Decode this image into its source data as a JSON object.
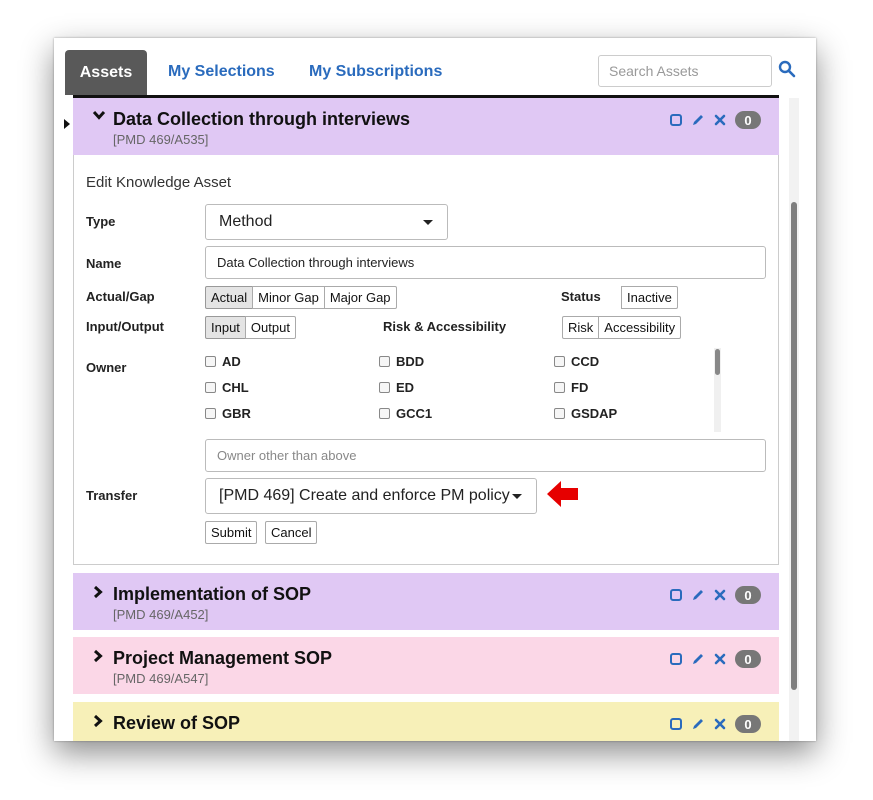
{
  "tabs": {
    "assets": "Assets",
    "my_selections": "My Selections",
    "my_subscriptions": "My Subscriptions"
  },
  "search": {
    "placeholder": "Search Assets",
    "icon": "search-icon"
  },
  "colors": {
    "tab_active": "#595959",
    "link": "#2a6bbd",
    "panel_purple": "#e0c8f4",
    "panel_pink": "#fbd7e7",
    "panel_yellow": "#f7f0b8",
    "icon_blue": "#2a6bbd",
    "arrow_red": "#e60000"
  },
  "assets": [
    {
      "title": "Data Collection through interviews",
      "code": "[PMD 469/A535]",
      "count": "0",
      "expanded": true
    },
    {
      "title": "Implementation of SOP",
      "code": "[PMD 469/A452]",
      "count": "0",
      "expanded": false
    },
    {
      "title": "Project Management SOP",
      "code": "[PMD 469/A547]",
      "count": "0",
      "expanded": false
    },
    {
      "title": "Review of SOP",
      "count": "0",
      "expanded": false
    }
  ],
  "form": {
    "heading": "Edit Knowledge Asset",
    "type_label": "Type",
    "type_value": "Method",
    "name_label": "Name",
    "name_value": "Data Collection through interviews",
    "actual_gap_label": "Actual/Gap",
    "actual_gap_options": [
      "Actual",
      "Minor Gap",
      "Major Gap"
    ],
    "actual_gap_selected": "Actual",
    "status_label": "Status",
    "status_options": [
      "Inactive"
    ],
    "input_output_label": "Input/Output",
    "input_output_options": [
      "Input",
      "Output"
    ],
    "input_output_selected": "Input",
    "risk_label": "Risk & Accessibility",
    "risk_options": [
      "Risk",
      "Accessibility"
    ],
    "owner_label": "Owner",
    "owners": [
      "AD",
      "BDD",
      "CCD",
      "CHL",
      "ED",
      "FD",
      "GBR",
      "GCC1",
      "GSDAP"
    ],
    "owner_other_placeholder": "Owner other than above",
    "transfer_label": "Transfer",
    "transfer_value": "[PMD 469] Create and enforce PM policy",
    "submit_label": "Submit",
    "cancel_label": "Cancel"
  }
}
